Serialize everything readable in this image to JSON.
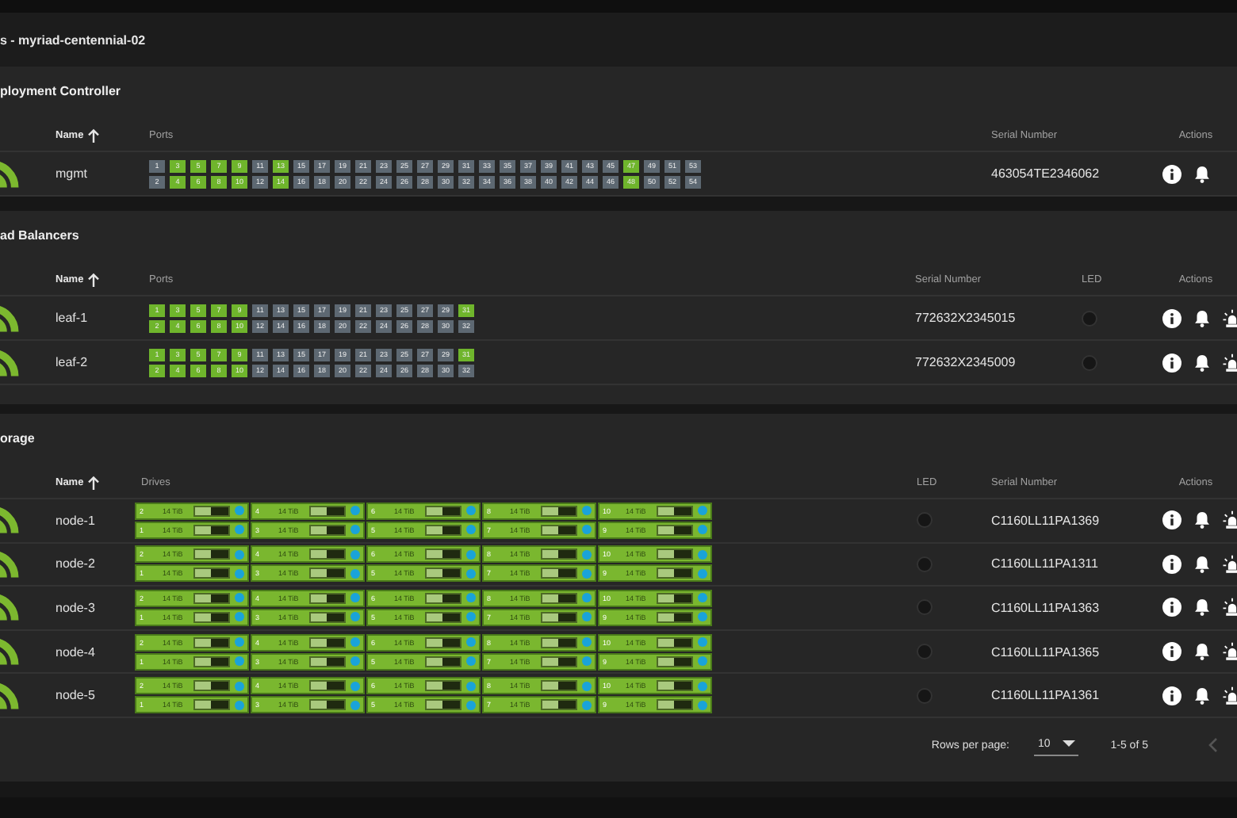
{
  "page_title": "s - myriad-centennial-02",
  "sections": [
    {
      "kind": "ports",
      "title": "ployment Controller",
      "columns": [
        {
          "kind": "name",
          "label": "Name",
          "sorted": true
        },
        {
          "kind": "ports",
          "label": "Ports",
          "sorted": false
        },
        {
          "kind": "serial",
          "label": "Serial Number",
          "sorted": false
        },
        {
          "kind": "actions",
          "label": "Actions",
          "sorted": false
        }
      ],
      "rows": [
        {
          "name": "mgmt",
          "serial": "463054TE2346062",
          "actions": [
            {
              "kind": "info"
            },
            {
              "kind": "bell"
            }
          ],
          "ports": [
            {
              "label": "1",
              "up": false
            },
            {
              "label": "2",
              "up": false
            },
            {
              "label": "3",
              "up": true
            },
            {
              "label": "4",
              "up": true
            },
            {
              "label": "5",
              "up": true
            },
            {
              "label": "6",
              "up": true
            },
            {
              "label": "7",
              "up": true
            },
            {
              "label": "8",
              "up": true
            },
            {
              "label": "9",
              "up": true
            },
            {
              "label": "10",
              "up": true
            },
            {
              "label": "11",
              "up": false
            },
            {
              "label": "12",
              "up": false
            },
            {
              "label": "13",
              "up": true
            },
            {
              "label": "14",
              "up": true
            },
            {
              "label": "15",
              "up": false
            },
            {
              "label": "16",
              "up": false
            },
            {
              "label": "17",
              "up": false
            },
            {
              "label": "18",
              "up": false
            },
            {
              "label": "19",
              "up": false
            },
            {
              "label": "20",
              "up": false
            },
            {
              "label": "21",
              "up": false
            },
            {
              "label": "22",
              "up": false
            },
            {
              "label": "23",
              "up": false
            },
            {
              "label": "24",
              "up": false
            },
            {
              "label": "25",
              "up": false
            },
            {
              "label": "26",
              "up": false
            },
            {
              "label": "27",
              "up": false
            },
            {
              "label": "28",
              "up": false
            },
            {
              "label": "29",
              "up": false
            },
            {
              "label": "30",
              "up": false
            },
            {
              "label": "31",
              "up": false
            },
            {
              "label": "32",
              "up": false
            },
            {
              "label": "33",
              "up": false
            },
            {
              "label": "34",
              "up": false
            },
            {
              "label": "35",
              "up": false
            },
            {
              "label": "36",
              "up": false
            },
            {
              "label": "37",
              "up": false
            },
            {
              "label": "38",
              "up": false
            },
            {
              "label": "39",
              "up": false
            },
            {
              "label": "40",
              "up": false
            },
            {
              "label": "41",
              "up": false
            },
            {
              "label": "42",
              "up": false
            },
            {
              "label": "43",
              "up": false
            },
            {
              "label": "44",
              "up": false
            },
            {
              "label": "45",
              "up": false
            },
            {
              "label": "46",
              "up": false
            },
            {
              "label": "47",
              "up": true
            },
            {
              "label": "48",
              "up": true
            },
            {
              "label": "49",
              "up": false
            },
            {
              "label": "50",
              "up": false
            },
            {
              "label": "51",
              "up": false
            },
            {
              "label": "52",
              "up": false
            },
            {
              "label": "53",
              "up": false
            },
            {
              "label": "54",
              "up": false
            }
          ]
        }
      ]
    },
    {
      "kind": "ports",
      "title": "ad Balancers",
      "columns": [
        {
          "kind": "name",
          "label": "Name",
          "sorted": true
        },
        {
          "kind": "ports",
          "label": "Ports",
          "sorted": false
        },
        {
          "kind": "serial",
          "label": "Serial Number",
          "sorted": false
        },
        {
          "kind": "led",
          "label": "LED",
          "sorted": false
        },
        {
          "kind": "actions",
          "label": "Actions",
          "sorted": false
        }
      ],
      "rows": [
        {
          "name": "leaf-1",
          "serial": "772632X2345015",
          "led_on": false,
          "actions": [
            {
              "kind": "info"
            },
            {
              "kind": "bell"
            },
            {
              "kind": "beacon"
            }
          ],
          "ports": [
            {
              "label": "1",
              "up": true
            },
            {
              "label": "2",
              "up": true
            },
            {
              "label": "3",
              "up": true
            },
            {
              "label": "4",
              "up": true
            },
            {
              "label": "5",
              "up": true
            },
            {
              "label": "6",
              "up": true
            },
            {
              "label": "7",
              "up": true
            },
            {
              "label": "8",
              "up": true
            },
            {
              "label": "9",
              "up": true
            },
            {
              "label": "10",
              "up": true
            },
            {
              "label": "11",
              "up": false
            },
            {
              "label": "12",
              "up": false
            },
            {
              "label": "13",
              "up": false
            },
            {
              "label": "14",
              "up": false
            },
            {
              "label": "15",
              "up": false
            },
            {
              "label": "16",
              "up": false
            },
            {
              "label": "17",
              "up": false
            },
            {
              "label": "18",
              "up": false
            },
            {
              "label": "19",
              "up": false
            },
            {
              "label": "20",
              "up": false
            },
            {
              "label": "21",
              "up": false
            },
            {
              "label": "22",
              "up": false
            },
            {
              "label": "23",
              "up": false
            },
            {
              "label": "24",
              "up": false
            },
            {
              "label": "25",
              "up": false
            },
            {
              "label": "26",
              "up": false
            },
            {
              "label": "27",
              "up": false
            },
            {
              "label": "28",
              "up": false
            },
            {
              "label": "29",
              "up": false
            },
            {
              "label": "30",
              "up": false
            },
            {
              "label": "31",
              "up": true
            },
            {
              "label": "32",
              "up": false
            }
          ]
        },
        {
          "name": "leaf-2",
          "serial": "772632X2345009",
          "led_on": false,
          "actions": [
            {
              "kind": "info"
            },
            {
              "kind": "bell"
            },
            {
              "kind": "beacon"
            }
          ],
          "ports": [
            {
              "label": "1",
              "up": true
            },
            {
              "label": "2",
              "up": true
            },
            {
              "label": "3",
              "up": true
            },
            {
              "label": "4",
              "up": true
            },
            {
              "label": "5",
              "up": true
            },
            {
              "label": "6",
              "up": true
            },
            {
              "label": "7",
              "up": true
            },
            {
              "label": "8",
              "up": true
            },
            {
              "label": "9",
              "up": true
            },
            {
              "label": "10",
              "up": true
            },
            {
              "label": "11",
              "up": false
            },
            {
              "label": "12",
              "up": false
            },
            {
              "label": "13",
              "up": false
            },
            {
              "label": "14",
              "up": false
            },
            {
              "label": "15",
              "up": false
            },
            {
              "label": "16",
              "up": false
            },
            {
              "label": "17",
              "up": false
            },
            {
              "label": "18",
              "up": false
            },
            {
              "label": "19",
              "up": false
            },
            {
              "label": "20",
              "up": false
            },
            {
              "label": "21",
              "up": false
            },
            {
              "label": "22",
              "up": false
            },
            {
              "label": "23",
              "up": false
            },
            {
              "label": "24",
              "up": false
            },
            {
              "label": "25",
              "up": false
            },
            {
              "label": "26",
              "up": false
            },
            {
              "label": "27",
              "up": false
            },
            {
              "label": "28",
              "up": false
            },
            {
              "label": "29",
              "up": false
            },
            {
              "label": "30",
              "up": false
            },
            {
              "label": "31",
              "up": true
            },
            {
              "label": "32",
              "up": false
            }
          ]
        }
      ]
    },
    {
      "kind": "drives",
      "title": "orage",
      "columns": [
        {
          "kind": "name",
          "label": "Name",
          "sorted": true
        },
        {
          "kind": "drives",
          "label": "Drives",
          "sorted": false
        },
        {
          "kind": "led",
          "label": "LED",
          "sorted": false
        },
        {
          "kind": "serial",
          "label": "Serial Number",
          "sorted": false
        },
        {
          "kind": "actions",
          "label": "Actions",
          "sorted": false
        }
      ],
      "rows": [
        {
          "name": "node-1",
          "serial": "C1160LL11PA1369",
          "led_on": false,
          "actions": [
            {
              "kind": "info"
            },
            {
              "kind": "bell"
            },
            {
              "kind": "beacon"
            }
          ],
          "drives": [
            {
              "label": "2",
              "size": "14 TiB",
              "level": 0.45
            },
            {
              "label": "4",
              "size": "14 TiB",
              "level": 0.45
            },
            {
              "label": "6",
              "size": "14 TiB",
              "level": 0.45
            },
            {
              "label": "8",
              "size": "14 TiB",
              "level": 0.45
            },
            {
              "label": "10",
              "size": "14 TiB",
              "level": 0.45
            },
            {
              "label": "1",
              "size": "14 TiB",
              "level": 0.45
            },
            {
              "label": "3",
              "size": "14 TiB",
              "level": 0.45
            },
            {
              "label": "5",
              "size": "14 TiB",
              "level": 0.45
            },
            {
              "label": "7",
              "size": "14 TiB",
              "level": 0.45
            },
            {
              "label": "9",
              "size": "14 TiB",
              "level": 0.45
            }
          ]
        },
        {
          "name": "node-2",
          "serial": "C1160LL11PA1311",
          "led_on": false,
          "actions": [
            {
              "kind": "info"
            },
            {
              "kind": "bell"
            },
            {
              "kind": "beacon"
            }
          ],
          "drives": [
            {
              "label": "2",
              "size": "14 TiB",
              "level": 0.45
            },
            {
              "label": "4",
              "size": "14 TiB",
              "level": 0.45
            },
            {
              "label": "6",
              "size": "14 TiB",
              "level": 0.45
            },
            {
              "label": "8",
              "size": "14 TiB",
              "level": 0.45
            },
            {
              "label": "10",
              "size": "14 TiB",
              "level": 0.45
            },
            {
              "label": "1",
              "size": "14 TiB",
              "level": 0.45
            },
            {
              "label": "3",
              "size": "14 TiB",
              "level": 0.45
            },
            {
              "label": "5",
              "size": "14 TiB",
              "level": 0.45
            },
            {
              "label": "7",
              "size": "14 TiB",
              "level": 0.45
            },
            {
              "label": "9",
              "size": "14 TiB",
              "level": 0.45
            }
          ]
        },
        {
          "name": "node-3",
          "serial": "C1160LL11PA1363",
          "led_on": false,
          "actions": [
            {
              "kind": "info"
            },
            {
              "kind": "bell"
            },
            {
              "kind": "beacon"
            }
          ],
          "drives": [
            {
              "label": "2",
              "size": "14 TiB",
              "level": 0.45
            },
            {
              "label": "4",
              "size": "14 TiB",
              "level": 0.45
            },
            {
              "label": "6",
              "size": "14 TiB",
              "level": 0.45
            },
            {
              "label": "8",
              "size": "14 TiB",
              "level": 0.45
            },
            {
              "label": "10",
              "size": "14 TiB",
              "level": 0.45
            },
            {
              "label": "1",
              "size": "14 TiB",
              "level": 0.45
            },
            {
              "label": "3",
              "size": "14 TiB",
              "level": 0.45
            },
            {
              "label": "5",
              "size": "14 TiB",
              "level": 0.45
            },
            {
              "label": "7",
              "size": "14 TiB",
              "level": 0.45
            },
            {
              "label": "9",
              "size": "14 TiB",
              "level": 0.45
            }
          ]
        },
        {
          "name": "node-4",
          "serial": "C1160LL11PA1365",
          "led_on": false,
          "actions": [
            {
              "kind": "info"
            },
            {
              "kind": "bell"
            },
            {
              "kind": "beacon"
            }
          ],
          "drives": [
            {
              "label": "2",
              "size": "14 TiB",
              "level": 0.45
            },
            {
              "label": "4",
              "size": "14 TiB",
              "level": 0.45
            },
            {
              "label": "6",
              "size": "14 TiB",
              "level": 0.45
            },
            {
              "label": "8",
              "size": "14 TiB",
              "level": 0.45
            },
            {
              "label": "10",
              "size": "14 TiB",
              "level": 0.45
            },
            {
              "label": "1",
              "size": "14 TiB",
              "level": 0.45
            },
            {
              "label": "3",
              "size": "14 TiB",
              "level": 0.45
            },
            {
              "label": "5",
              "size": "14 TiB",
              "level": 0.45
            },
            {
              "label": "7",
              "size": "14 TiB",
              "level": 0.45
            },
            {
              "label": "9",
              "size": "14 TiB",
              "level": 0.45
            }
          ]
        },
        {
          "name": "node-5",
          "serial": "C1160LL11PA1361",
          "led_on": false,
          "actions": [
            {
              "kind": "info"
            },
            {
              "kind": "bell"
            },
            {
              "kind": "beacon"
            }
          ],
          "drives": [
            {
              "label": "2",
              "size": "14 TiB",
              "level": 0.45
            },
            {
              "label": "4",
              "size": "14 TiB",
              "level": 0.45
            },
            {
              "label": "6",
              "size": "14 TiB",
              "level": 0.45
            },
            {
              "label": "8",
              "size": "14 TiB",
              "level": 0.45
            },
            {
              "label": "10",
              "size": "14 TiB",
              "level": 0.45
            },
            {
              "label": "1",
              "size": "14 TiB",
              "level": 0.45
            },
            {
              "label": "3",
              "size": "14 TiB",
              "level": 0.45
            },
            {
              "label": "5",
              "size": "14 TiB",
              "level": 0.45
            },
            {
              "label": "7",
              "size": "14 TiB",
              "level": 0.45
            },
            {
              "label": "9",
              "size": "14 TiB",
              "level": 0.45
            }
          ]
        }
      ],
      "pagination": {
        "rows_per_page_label": "Rows per page:",
        "rows_per_page": "10",
        "range": "1-5 of 5",
        "prev_disabled": true
      }
    }
  ]
}
